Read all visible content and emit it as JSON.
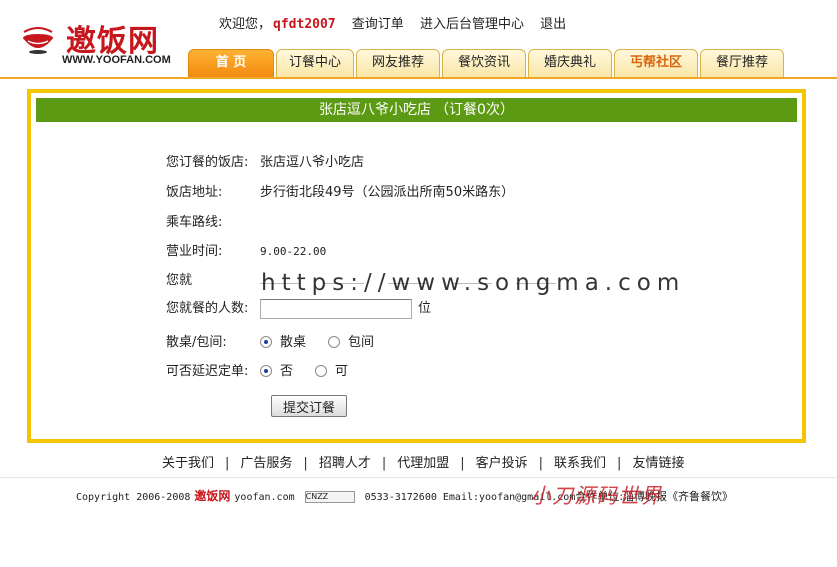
{
  "header": {
    "brand": "邀饭网",
    "brand_url": "WWW.YOOFAN.COM",
    "welcome": "欢迎您，",
    "username": "qfdt2007",
    "links": [
      "查询订单",
      "进入后台管理中心",
      "退出"
    ]
  },
  "nav": {
    "tabs": [
      {
        "label": "首 页",
        "state": "active"
      },
      {
        "label": "订餐中心",
        "state": "normal"
      },
      {
        "label": "网友推荐",
        "state": "normal"
      },
      {
        "label": "餐饮资讯",
        "state": "normal"
      },
      {
        "label": "婚庆典礼",
        "state": "normal"
      },
      {
        "label": "丐帮社区",
        "state": "highlight"
      },
      {
        "label": "餐厅推荐",
        "state": "normal"
      }
    ]
  },
  "order": {
    "shop_title": "张店逗八爷小吃店",
    "order_count": "（订餐0次）",
    "fields": {
      "shop_label": "您订餐的饭店:",
      "shop_value": "张店逗八爷小吃店",
      "address_label": "饭店地址:",
      "address_value": "步行街北段49号（公园派出所南50米路东）",
      "route_label": "乘车路线:",
      "route_value": "",
      "hours_label": "营业时间:",
      "hours_value": "9.00-22.00",
      "time_label": "您就",
      "people_label": "您就餐的人数:",
      "people_value": "",
      "people_unit": "位",
      "seat_label": "散桌/包间:",
      "seat_options": [
        "散桌",
        "包间"
      ],
      "seat_selected": "散桌",
      "delay_label": "可否延迟定单:",
      "delay_options": [
        "否",
        "可"
      ],
      "delay_selected": "否"
    },
    "submit_label": "提交订餐"
  },
  "watermark": "https://www.songma.com",
  "footer": {
    "links": [
      "关于我们",
      "广告服务",
      "招聘人才",
      "代理加盟",
      "客户投诉",
      "联系我们",
      "友情链接"
    ],
    "copyright": "Copyright 2006-2008",
    "brand": "邀饭网",
    "domain": "yoofan.com",
    "badge": "CNZZ",
    "contact": "0533-3172600 Email:yoofan@gmail.com",
    "partner": "合作单位:淄博晚报《齐鲁餐饮》",
    "signature": "小刀源码世界"
  },
  "colors": {
    "brand_red": "#c8161d",
    "title_green": "#5c9a13",
    "frame_yellow": "#f5c400",
    "tab_orange": "#f28a10"
  }
}
